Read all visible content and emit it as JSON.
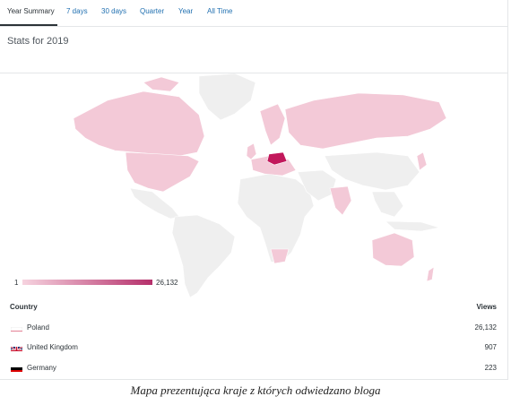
{
  "tabs": [
    {
      "label": "Year Summary",
      "active": true
    },
    {
      "label": "7 days"
    },
    {
      "label": "30 days"
    },
    {
      "label": "Quarter"
    },
    {
      "label": "Year"
    },
    {
      "label": "All Time"
    }
  ],
  "stats_title": "Stats for 2019",
  "legend": {
    "min": "1",
    "max": "26,132",
    "color_low": "#f6d3df",
    "color_high": "#b5306b"
  },
  "map_colors": {
    "land_default": "#efefef",
    "land_low": "#f3c9d7",
    "highlight": "#c2185b",
    "border": "#ffffff"
  },
  "table": {
    "country_header": "Country",
    "views_header": "Views",
    "rows": [
      {
        "country": "Poland",
        "views": "26,132",
        "flag_icon": "poland-flag-icon"
      },
      {
        "country": "United Kingdom",
        "views": "907",
        "flag_icon": "uk-flag-icon"
      },
      {
        "country": "Germany",
        "views": "223",
        "flag_icon": "germany-flag-icon"
      }
    ]
  },
  "caption": "Mapa prezentująca kraje z których odwiedzano bloga"
}
